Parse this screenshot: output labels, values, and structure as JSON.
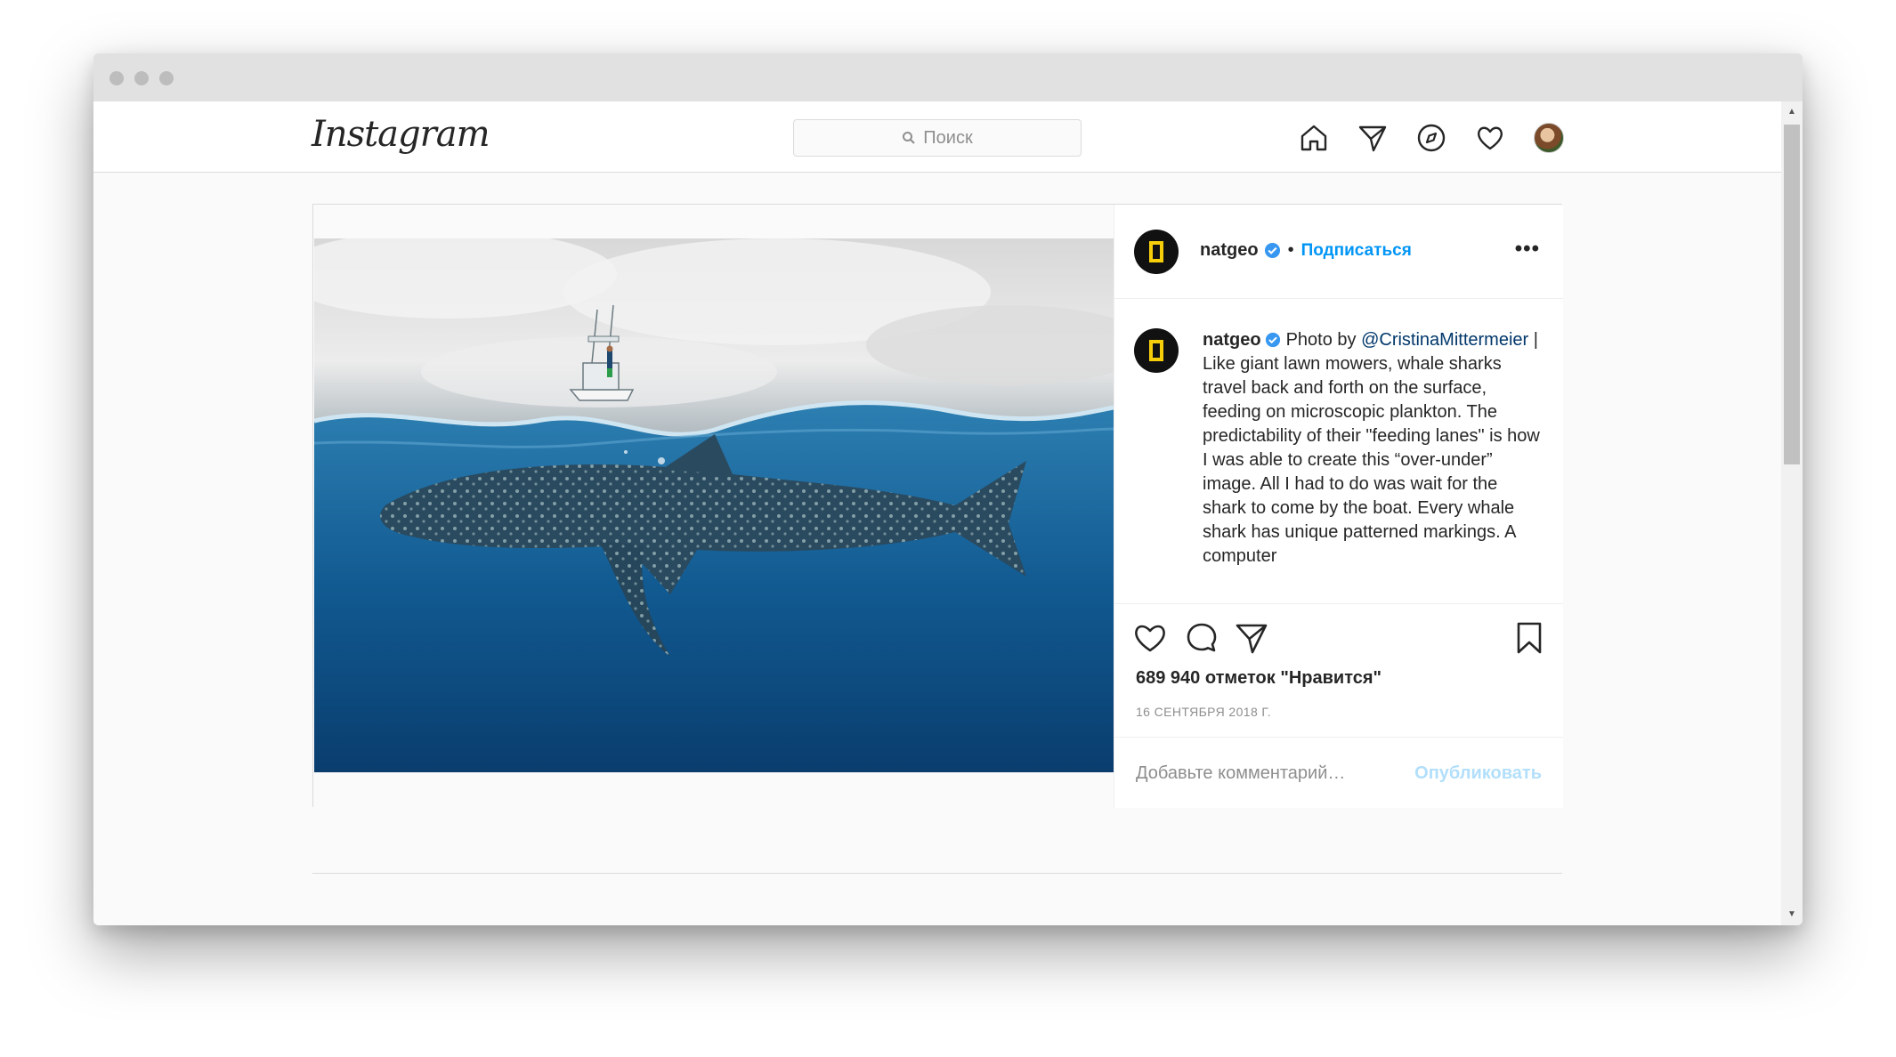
{
  "window": {
    "controls": [
      "close",
      "minimize",
      "maximize"
    ]
  },
  "nav": {
    "logo": "Instagram",
    "search": {
      "placeholder": "Поиск",
      "icon": "search-icon"
    },
    "icons": [
      "home-icon",
      "direct-icon",
      "explore-icon",
      "activity-heart-icon",
      "profile-avatar"
    ]
  },
  "post": {
    "image": {
      "description_icon": "whale-shark-photo"
    },
    "header": {
      "username": "natgeo",
      "verified": true,
      "separator": "•",
      "follow_label": "Подписаться",
      "more_label": "•••"
    },
    "caption": {
      "username": "natgeo",
      "prefix": "Photo by",
      "mention": "@CristinaMittermeier",
      "text": " | Like giant lawn mowers, whale sharks travel back and forth on the surface, feeding on microscopic plankton. The predictability of their \"feeding lanes\" is how I was able to create this “over-under” image. All I had to do was wait for the shark to come by the boat. Every whale shark has unique patterned markings. A computer"
    },
    "likes": "689 940 отметок \"Нравится\"",
    "date": "16 СЕНТЯБРЯ 2018 Г.",
    "comment": {
      "placeholder": "Добавьте комментарий…",
      "publish_label": "Опубликовать"
    }
  },
  "colors": {
    "accent": "#0095f6",
    "publish_disabled": "#b2dffc",
    "verified": "#3897f0",
    "ng_yellow": "#f6cf0a"
  }
}
